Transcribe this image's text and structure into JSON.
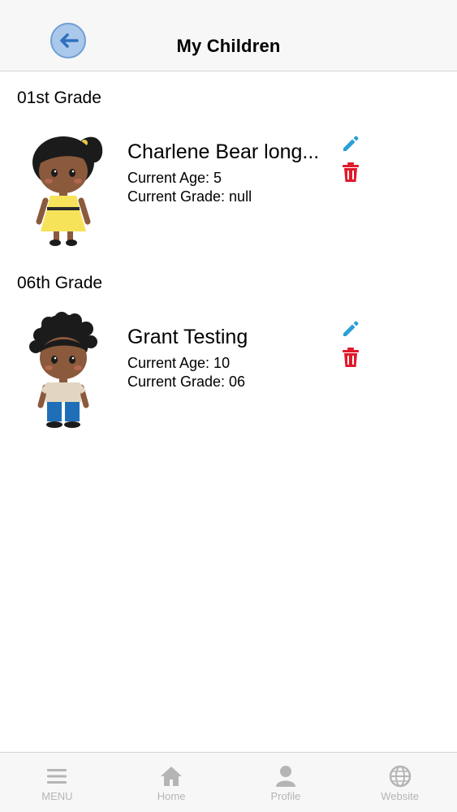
{
  "header": {
    "title": "My Children"
  },
  "groups": [
    {
      "grade_title": "01st Grade",
      "child": {
        "name": "Charlene Bear long...",
        "age_text": "Current Age: 5",
        "grade_text": "Current Grade: null",
        "avatar": "girl-avatar-icon"
      }
    },
    {
      "grade_title": "06th Grade",
      "child": {
        "name": "Grant Testing",
        "age_text": "Current Age: 10",
        "grade_text": "Current Grade: 06",
        "avatar": "boy-avatar-icon"
      }
    }
  ],
  "tabs": [
    {
      "label": "MENU",
      "icon": "menu-icon"
    },
    {
      "label": "Home",
      "icon": "home-icon"
    },
    {
      "label": "Profile",
      "icon": "profile-icon"
    },
    {
      "label": "Website",
      "icon": "globe-icon"
    }
  ],
  "colors": {
    "accent_blue": "#2a9fd8",
    "delete_red": "#e0192b",
    "back_button_fill": "#a9c8ea",
    "tab_inactive": "#b5b5b5"
  }
}
